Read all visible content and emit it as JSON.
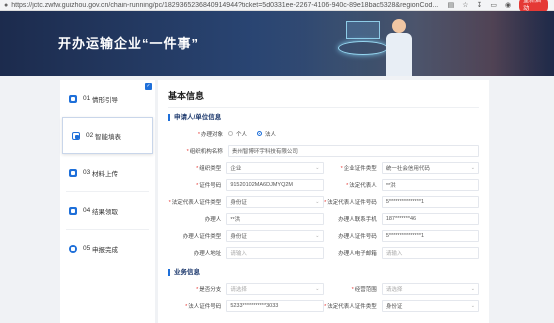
{
  "browser": {
    "url": "https://jctc.zwfw.guizhou.gov.cn/chain-running/pc/1829365236840914944?ticket=5d0331ee-2267-4106-940c-89e18bac5328&regionCod...",
    "restart_label": "重新启动"
  },
  "banner": {
    "title": "开办运输企业“一件事”"
  },
  "steps": [
    {
      "num": "01",
      "label": "情形引导"
    },
    {
      "num": "02",
      "label": "智能填表"
    },
    {
      "num": "03",
      "label": "材料上传"
    },
    {
      "num": "04",
      "label": "结果领取"
    },
    {
      "num": "05",
      "label": "申报完成"
    }
  ],
  "section": {
    "title": "基本信息",
    "applicant_title": "申请人/单位信息",
    "business_title": "业务信息"
  },
  "form": {
    "handler_label": "办理对象",
    "handler_opt1": "个人",
    "handler_opt2": "法人",
    "org_name_label": "组织机构名称",
    "org_name_value": "贵州智博环宇科技有限公司",
    "org_type_label": "组织类型",
    "org_type_value": "企业",
    "cert_type_label": "企业证件类型",
    "cert_type_value": "统一社会信用代码",
    "cert_no_label": "证件号码",
    "cert_no_value": "91520102MA6DJMYQ2M",
    "legal_rep_label": "法定代表人",
    "legal_rep_value": "**洪",
    "legal_id_type_label": "法定代表人证件类型",
    "legal_id_type_value": "身份证",
    "legal_id_no_label": "法定代表人证件号码",
    "legal_id_no_value": "5***************1",
    "agent_label": "办理人",
    "agent_value": "**洪",
    "agent_phone_label": "办理人联系手机",
    "agent_phone_value": "187*******46",
    "agent_id_type_label": "办理人证件类型",
    "agent_id_type_value": "身份证",
    "agent_id_no_label": "办理人证件号码",
    "agent_id_no_value": "5***************1",
    "agent_addr_label": "办理人地址",
    "agent_addr_placeholder": "请输入",
    "agent_email_label": "办理人电子邮箱",
    "agent_email_placeholder": "请输入"
  },
  "business": {
    "branch_label": "是否分支",
    "branch_placeholder": "请选择",
    "scope_label": "经营范围",
    "scope_placeholder": "请选择",
    "legal_id_no_label": "法人证件号码",
    "legal_id_no_value": "5233***********3033",
    "legal_id_type_label": "法定代表人证件类型",
    "legal_id_type_value": "身份证"
  }
}
